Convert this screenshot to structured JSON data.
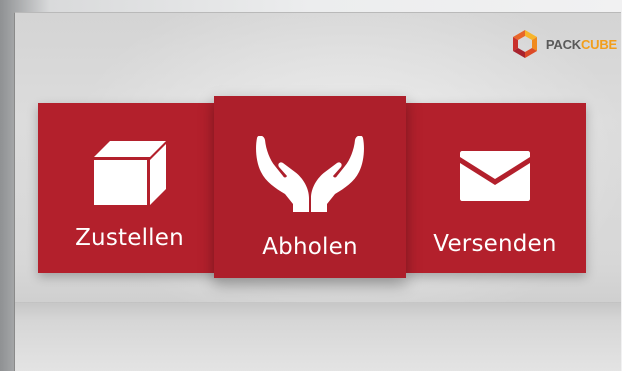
{
  "brand": {
    "logo_text_part1": "PACK",
    "logo_text_part2": "CUBE",
    "logo_icon": "cube-logo-icon",
    "colors": {
      "pack": "#5a5a5a",
      "cube": "#f29e1b"
    }
  },
  "menu": {
    "accent_color": "#b3202c",
    "tiles": [
      {
        "label": "Zustellen",
        "icon": "package-box-icon"
      },
      {
        "label": "Abholen",
        "icon": "open-hands-icon"
      },
      {
        "label": "Versenden",
        "icon": "envelope-icon"
      }
    ]
  }
}
